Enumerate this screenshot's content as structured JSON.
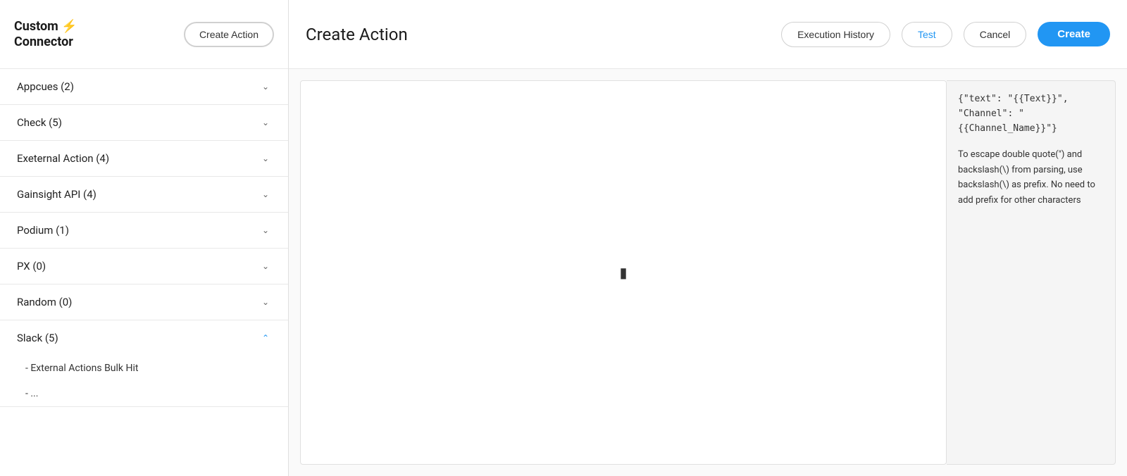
{
  "sidebar": {
    "brand": {
      "line1": "Custom",
      "line2": "Connector",
      "lightning_icon": "⚡"
    },
    "create_action_label": "Create Action",
    "groups": [
      {
        "id": "appcues",
        "label": "Appcues (2)",
        "expanded": false,
        "chevron": "down",
        "subitems": []
      },
      {
        "id": "check",
        "label": "Check (5)",
        "expanded": false,
        "chevron": "down",
        "subitems": []
      },
      {
        "id": "external_action",
        "label": "Exeternal Action (4)",
        "expanded": false,
        "chevron": "down",
        "subitems": []
      },
      {
        "id": "gainsight_api",
        "label": "Gainsight API (4)",
        "expanded": false,
        "chevron": "down",
        "subitems": []
      },
      {
        "id": "podium",
        "label": "Podium (1)",
        "expanded": false,
        "chevron": "down",
        "subitems": []
      },
      {
        "id": "px",
        "label": "PX (0)",
        "expanded": false,
        "chevron": "down",
        "subitems": []
      },
      {
        "id": "random",
        "label": "Random (0)",
        "expanded": false,
        "chevron": "down",
        "subitems": []
      },
      {
        "id": "slack",
        "label": "Slack (5)",
        "expanded": true,
        "chevron": "up",
        "subitems": [
          "- External Actions Bulk Hit",
          "- ..."
        ]
      }
    ]
  },
  "header": {
    "title": "Create Action",
    "execution_history_label": "Execution History",
    "test_label": "Test",
    "cancel_label": "Cancel",
    "create_label": "Create"
  },
  "info_panel": {
    "code_line1": "{\"text\": \"{{Text}}\",",
    "code_line2": "\"Channel\": \"",
    "code_line3": "{{Channel_Name}}\"}",
    "description": "To escape double quote(\") and backslash(\\) from parsing, use backslash(\\) as prefix. No need to add prefix for other characters"
  },
  "editor": {
    "placeholder": ""
  }
}
